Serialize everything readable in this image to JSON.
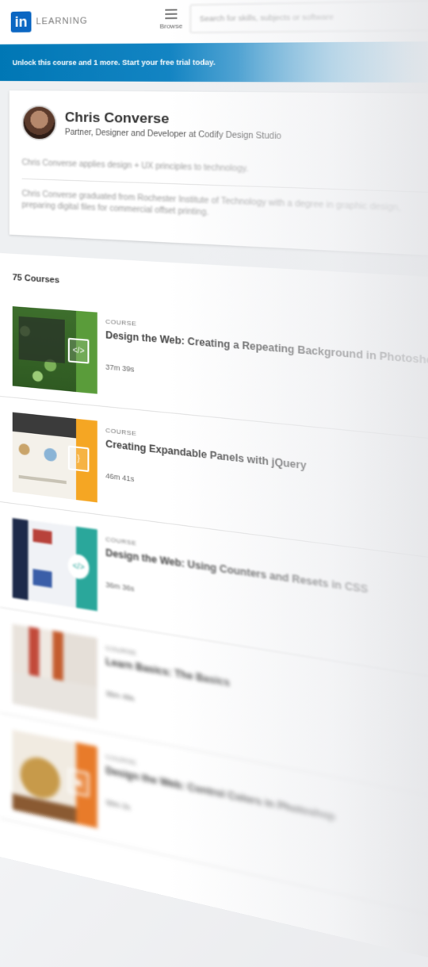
{
  "header": {
    "logo_badge": "in",
    "logo_text": "LEARNING",
    "browse_label": "Browse",
    "search_placeholder": "Search for skills, subjects or software"
  },
  "banner": {
    "text": "Unlock this course and 1 more. Start your free trial today."
  },
  "profile": {
    "name": "Chris Converse",
    "role": "Partner, Designer and Developer at Codify Design Studio",
    "bio_1": "Chris Converse applies design + UX principles to technology.",
    "bio_2": "Chris Converse graduated from Rochester Institute of Technology with a degree in graphic design, preparing digital files for commercial offset printing."
  },
  "courses_count": "75 Courses",
  "courses": [
    {
      "type": "COURSE",
      "title": "Design the Web: Creating a Repeating Background in Photoshop",
      "duration": "37m 39s",
      "stripe_color": "#5a9c3a",
      "icon": "code-icon"
    },
    {
      "type": "COURSE",
      "title": "Creating Expandable Panels with jQuery",
      "duration": "46m 41s",
      "stripe_color": "#f5a623",
      "icon": "jquery-icon"
    },
    {
      "type": "COURSE",
      "title": "Design the Web: Using Counters and Resets in CSS",
      "duration": "36m 36s",
      "stripe_color": "#2aa79b",
      "icon": "code-icon"
    },
    {
      "type": "COURSE",
      "title": "Learn Basics: The Basics",
      "duration": "35m 49s",
      "stripe_color": "#d9d9d9",
      "icon": "image-icon"
    },
    {
      "type": "COURSE",
      "title": "Design the Web: Control Colors in Photoshop",
      "duration": "30m 2s",
      "stripe_color": "#e87b2a",
      "icon": "image-icon"
    }
  ]
}
